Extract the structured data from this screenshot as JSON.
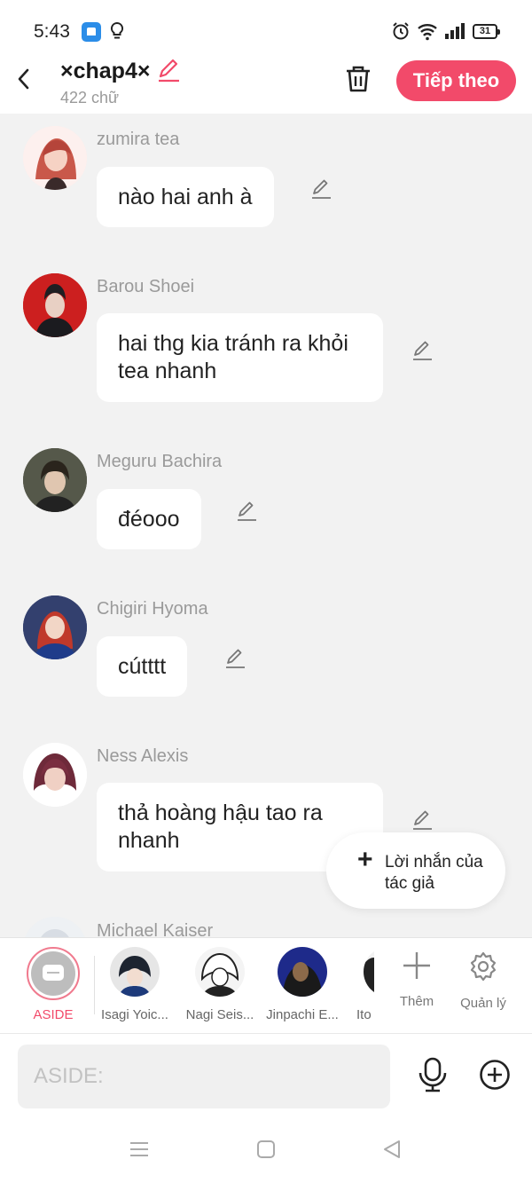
{
  "status_bar": {
    "time": "5:43",
    "battery": "31"
  },
  "header": {
    "title": "×chap4×",
    "word_count": "422 chữ",
    "next_label": "Tiếp theo"
  },
  "messages": [
    {
      "sender": "zumira tea",
      "text": "nào hai anh à"
    },
    {
      "sender": "Barou Shoei",
      "text": "hai thg kia tránh ra khỏi tea nhanh"
    },
    {
      "sender": "Meguru Bachira",
      "text": "đéooo"
    },
    {
      "sender": "Chigiri Hyoma",
      "text": "cútttt"
    },
    {
      "sender": "Ness Alexis",
      "text": "thả hoàng hậu tao ra nhanh"
    },
    {
      "sender": "Michael Kaiser",
      "text": ""
    }
  ],
  "author_note": {
    "label": "Lời nhắn của tác giả"
  },
  "characters": [
    {
      "name": "ASIDE"
    },
    {
      "name": "Isagi Yoic..."
    },
    {
      "name": "Nagi Seis..."
    },
    {
      "name": "Jinpachi E..."
    },
    {
      "name": "Ito"
    }
  ],
  "tools": {
    "more_label": "Thêm",
    "manage_label": "Quản lý"
  },
  "input": {
    "placeholder": "ASIDE:"
  },
  "colors": {
    "accent": "#f24a6a",
    "background": "#f2f2f2"
  }
}
